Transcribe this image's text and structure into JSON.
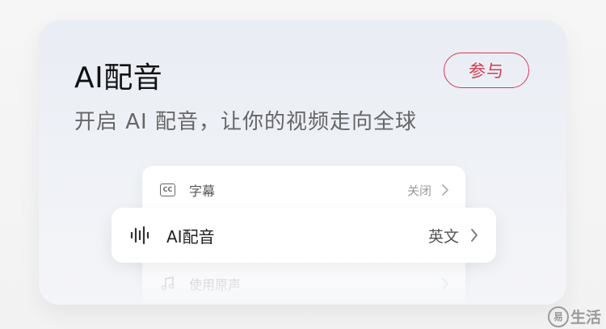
{
  "card": {
    "title": "AI配音",
    "subtitle": "开启 AI 配音，让你的视频走向全球",
    "join_button": "参与"
  },
  "settings": {
    "rows": [
      {
        "label": "字幕",
        "value": "关闭",
        "icon": "cc-icon"
      },
      {
        "label": "AI配音",
        "value": "英文",
        "icon": "waveform-icon"
      },
      {
        "label": "使用原声",
        "value": "",
        "icon": "music-note-icon"
      }
    ]
  },
  "watermark": {
    "text": "生活",
    "logo_text": "易"
  },
  "colors": {
    "accent": "#d53b50"
  }
}
